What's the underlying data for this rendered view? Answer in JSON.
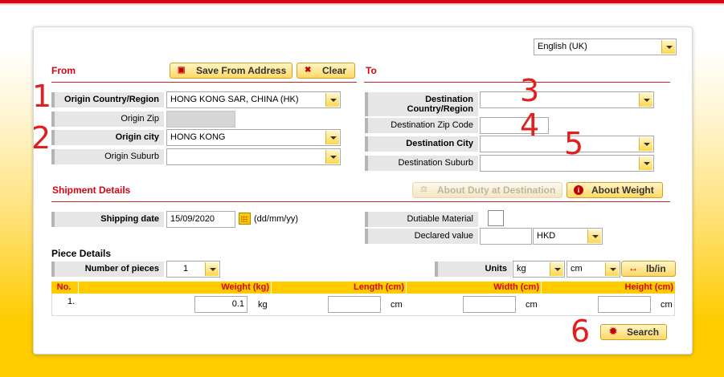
{
  "language": {
    "selected": "English (UK)"
  },
  "from": {
    "title": "From",
    "save_button": "Save From Address",
    "clear_button": "Clear",
    "origin_country_label": "Origin Country/Region",
    "origin_country_value": "HONG KONG SAR, CHINA (HK)",
    "origin_zip_label": "Origin Zip",
    "origin_zip_value": "",
    "origin_city_label": "Origin city",
    "origin_city_value": "HONG KONG",
    "origin_suburb_label": "Origin Suburb",
    "origin_suburb_value": ""
  },
  "to": {
    "title": "To",
    "destination_country_label": "Destination Country/Region",
    "destination_country_value": "",
    "destination_zip_label": "Destination Zip Code",
    "destination_zip_value": "",
    "destination_city_label": "Destination City",
    "destination_city_value": "",
    "destination_suburb_label": "Destination Suburb",
    "destination_suburb_value": ""
  },
  "shipment": {
    "title": "Shipment Details",
    "about_duty_button": "About Duty at Destination",
    "about_weight_button": "About Weight",
    "shipping_date_label": "Shipping date",
    "shipping_date_value": "15/09/2020",
    "date_format_hint": "(dd/mm/yy)",
    "dutiable_label": "Dutiable Material",
    "declared_value_label": "Declared value",
    "declared_value_value": "",
    "currency": "HKD"
  },
  "pieces": {
    "title": "Piece Details",
    "number_label": "Number of pieces",
    "number_value": "1",
    "units_label": "Units",
    "weight_unit": "kg",
    "length_unit": "cm",
    "toggle_button": "lb/in",
    "columns": [
      "No.",
      "Weight (kg)",
      "Length (cm)",
      "Width (cm)",
      "Height (cm)"
    ],
    "rows": [
      {
        "no": "1.",
        "weight": "0.1",
        "weight_unit": "kg",
        "length": "",
        "length_unit": "cm",
        "width": "",
        "width_unit": "cm",
        "height": "",
        "height_unit": "cm"
      }
    ]
  },
  "search_button": "Search",
  "annotations": [
    "1",
    "2",
    "3",
    "4",
    "5",
    "6"
  ],
  "colors": {
    "brand_red": "#d40511",
    "brand_yellow": "#ffcc00",
    "annotation_red": "#e0201f"
  }
}
